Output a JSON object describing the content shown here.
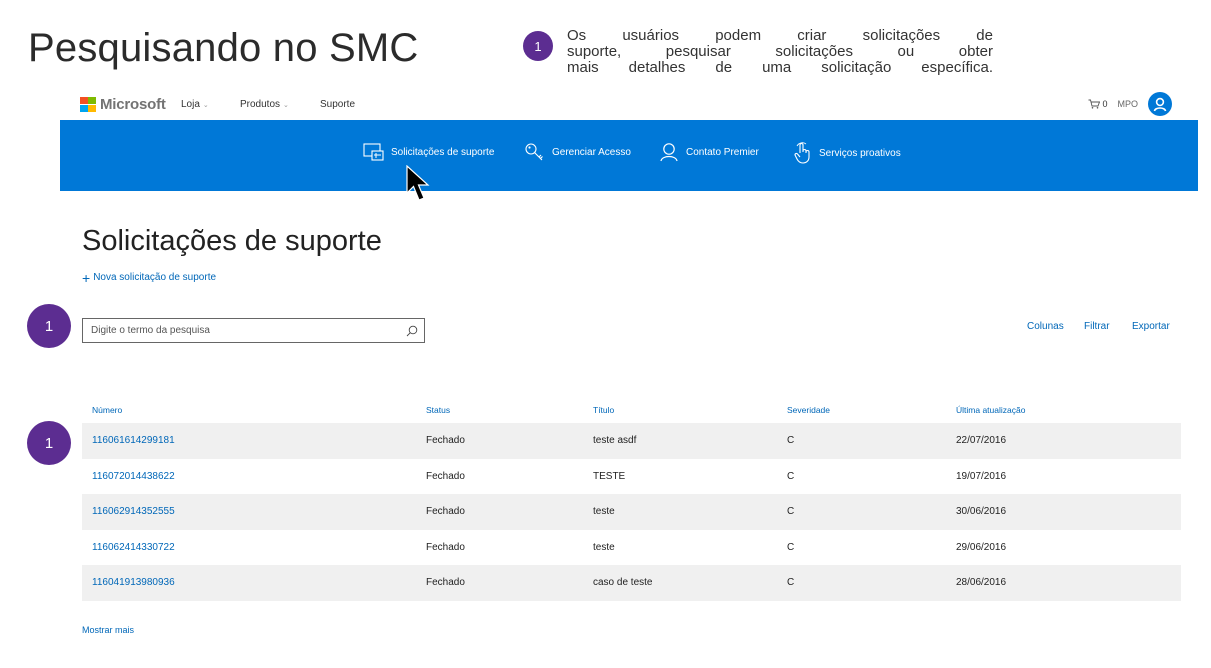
{
  "slide": {
    "title": "Pesquisando no SMC",
    "callout_number": "1",
    "callout_lines": [
      "Os usuários podem criar solicitações de",
      "suporte, pesquisar solicitações ou obter",
      "mais detalhes de uma solicitação específica."
    ]
  },
  "ms_header": {
    "brand": "Microsoft",
    "nav": [
      "Loja",
      "Produtos",
      "Suporte"
    ],
    "cart_count": "0",
    "user_initials": "MPO"
  },
  "blue_nav": {
    "items": [
      {
        "label": "Solicitações de suporte",
        "icon": "support-request-icon"
      },
      {
        "label": "Gerenciar Acesso",
        "icon": "key-icon"
      },
      {
        "label": "Contato Premier",
        "icon": "person-icon"
      },
      {
        "label": "Serviços proativos",
        "icon": "hand-touch-icon"
      }
    ]
  },
  "main": {
    "heading": "Solicitações de suporte",
    "new_request_label": "Nova solicitação de suporte",
    "search_placeholder": "Digite o termo da pesquisa",
    "actions": [
      "Colunas",
      "Filtrar",
      "Exportar"
    ],
    "badge_search": "1",
    "badge_table": "1",
    "show_more": "Mostrar mais"
  },
  "table": {
    "columns": [
      "Número",
      "Status",
      "Título",
      "Severidade",
      "Última atualização"
    ],
    "rows": [
      [
        "116061614299181",
        "Fechado",
        "teste asdf",
        "C",
        "22/07/2016"
      ],
      [
        "116072014438622",
        "Fechado",
        "TESTE",
        "C",
        "19/07/2016"
      ],
      [
        "116062914352555",
        "Fechado",
        "teste",
        "C",
        "30/06/2016"
      ],
      [
        "116062414330722",
        "Fechado",
        "teste",
        "C",
        "29/06/2016"
      ],
      [
        "116041913980936",
        "Fechado",
        "caso de teste",
        "C",
        "28/06/2016"
      ]
    ]
  },
  "colors": {
    "accent_blue": "#0078d7",
    "link_blue": "#0067b8",
    "badge_purple": "#5c2d91",
    "row_alt": "#f0f0f0"
  }
}
